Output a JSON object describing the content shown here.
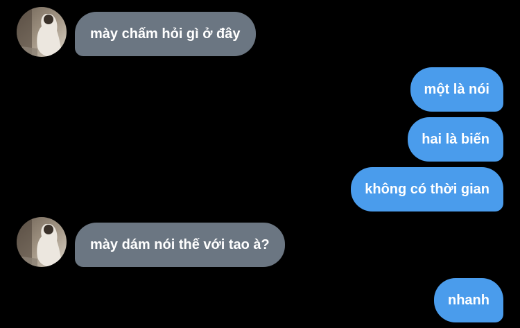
{
  "conversation": {
    "avatar_icon": "contact-avatar-photo",
    "colors": {
      "background": "#000000",
      "incoming_bubble": "#6b7682",
      "outgoing_bubble": "#4a9cec",
      "text": "#ffffff"
    },
    "messages": [
      {
        "direction": "incoming",
        "text": "mày chấm hỏi gì ở đây"
      },
      {
        "direction": "outgoing",
        "text": "một là nói"
      },
      {
        "direction": "outgoing",
        "text": "hai là biến"
      },
      {
        "direction": "outgoing",
        "text": "không có thời gian"
      },
      {
        "direction": "incoming",
        "text": "mày dám nói thế với tao à?"
      },
      {
        "direction": "outgoing",
        "text": "nhanh"
      }
    ]
  }
}
